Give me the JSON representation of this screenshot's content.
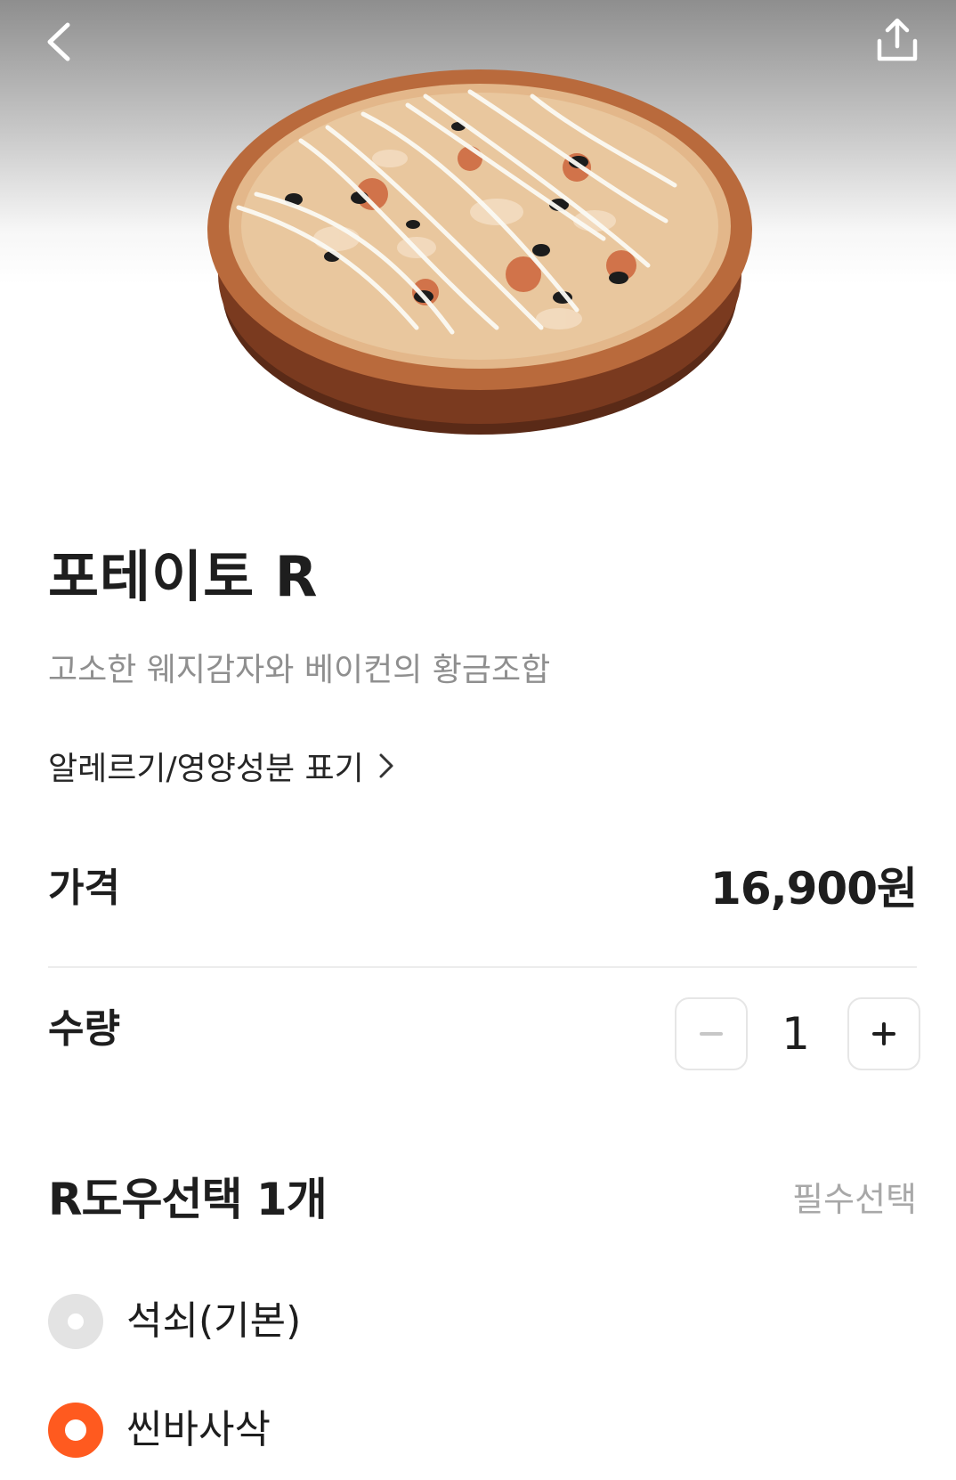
{
  "header": {
    "back_icon": "chevron-left-icon",
    "share_icon": "share-icon",
    "image": "pizza-photo"
  },
  "product": {
    "name": "포테이토 R",
    "description": "고소한 웨지감자와 베이컨의 황금조합",
    "allergy_link": "알레르기/영양성분 표기"
  },
  "price": {
    "label": "가격",
    "value": "16,900원"
  },
  "quantity": {
    "label": "수량",
    "value": "1",
    "minus_icon": "minus-icon",
    "plus_icon": "plus-icon"
  },
  "dough_section": {
    "title": "R도우선택 1개",
    "badge": "필수선택",
    "options": [
      {
        "label": "석쇠(기본)",
        "selected": false
      },
      {
        "label": "씬바사삭",
        "selected": true
      }
    ]
  },
  "colors": {
    "accent": "#ff5a1f",
    "radio_off": "#e3e3e3",
    "muted_text": "#8f8f8f"
  }
}
